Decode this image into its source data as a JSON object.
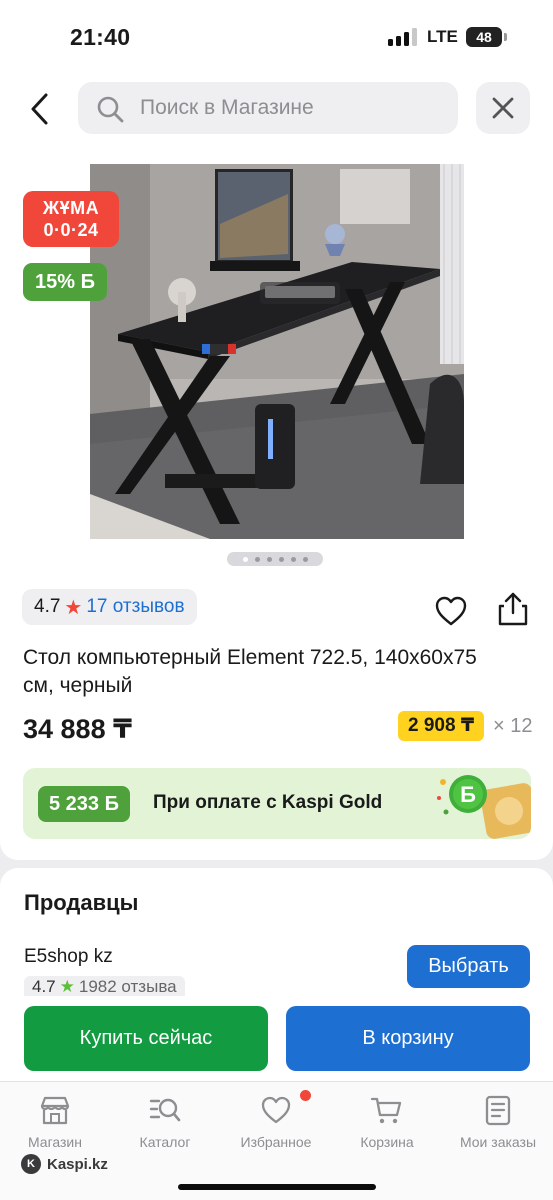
{
  "status_bar": {
    "time": "21:40",
    "network": "LTE",
    "battery": "48"
  },
  "header": {
    "search_placeholder": "Поиск в Магазине",
    "back_icon": "chevron-left-icon",
    "close_icon": "close-icon"
  },
  "product": {
    "badge_day_line1": "ЖҰМА",
    "badge_day_line2": "0·0·24",
    "discount_badge": "15% Б",
    "gallery_pages": 6,
    "gallery_active": 1,
    "rating": "4.7",
    "reviews": "17 отзывов",
    "title": "Стол компьютерный Element 722.5, 140x60x75 см, черный",
    "price": "34 888 ₸",
    "installment": "2 908 ₸",
    "installment_count": "× 12",
    "bonus_amount": "5 233 Б",
    "bonus_text": "При оплате с Kaspi Gold"
  },
  "sellers": {
    "title": "Продавцы",
    "seller_name": "E5shop kz",
    "seller_rating": "4.7",
    "seller_reviews": "1982 отзыва",
    "choose_label": "Выбрать"
  },
  "actions": {
    "buy_now": "Купить сейчас",
    "add_to_cart": "В корзину"
  },
  "tabs": [
    {
      "label": "Магазин",
      "icon": "store-icon"
    },
    {
      "label": "Каталог",
      "icon": "catalog-icon"
    },
    {
      "label": "Избранное",
      "icon": "heart-icon"
    },
    {
      "label": "Корзина",
      "icon": "cart-icon"
    },
    {
      "label": "Мои заказы",
      "icon": "orders-icon"
    }
  ],
  "watermark": "Kaspi.kz",
  "colors": {
    "red": "#f1473a",
    "green": "#4fa13b",
    "blue": "#1d6fd2",
    "buy_green": "#129b41",
    "yellow": "#ffd21f"
  }
}
